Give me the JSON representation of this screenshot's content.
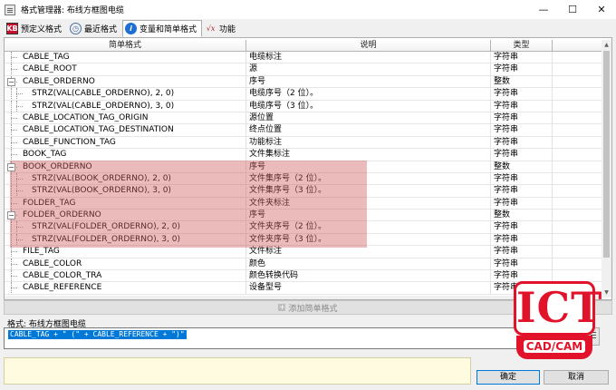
{
  "window": {
    "title": "格式管理器: 布线方框图电缆",
    "minimize": "—",
    "maximize": "☐",
    "close": "✕"
  },
  "tabs": [
    {
      "label": "预定义格式",
      "icon": "predefined-format-icon"
    },
    {
      "label": "最近格式",
      "icon": "clock-icon"
    },
    {
      "label": "变量和简单格式",
      "icon": "info-icon"
    },
    {
      "label": "功能",
      "icon": "function-fx-icon"
    }
  ],
  "active_tab": 2,
  "table": {
    "headers": [
      "简单格式",
      "说明",
      "类型",
      ""
    ],
    "rows": [
      {
        "name": "CABLE_TAG",
        "desc": "电缆标注",
        "type": "字符串",
        "level": 0,
        "expander": ""
      },
      {
        "name": "CABLE_ROOT",
        "desc": "源",
        "type": "字符串",
        "level": 0,
        "expander": ""
      },
      {
        "name": "CABLE_ORDERNO",
        "desc": "序号",
        "type": "整数",
        "level": 0,
        "expander": "−"
      },
      {
        "name": "STRZ(VAL(CABLE_ORDERNO), 2, 0)",
        "desc": "电缆序号（2 位）。",
        "type": "字符串",
        "level": 1,
        "expander": ""
      },
      {
        "name": "STRZ(VAL(CABLE_ORDERNO), 3, 0)",
        "desc": "电缆序号（3 位）。",
        "type": "字符串",
        "level": 1,
        "expander": ""
      },
      {
        "name": "CABLE_LOCATION_TAG_ORIGIN",
        "desc": "源位置",
        "type": "字符串",
        "level": 0,
        "expander": ""
      },
      {
        "name": "CABLE_LOCATION_TAG_DESTINATION",
        "desc": "终点位置",
        "type": "字符串",
        "level": 0,
        "expander": ""
      },
      {
        "name": "CABLE_FUNCTION_TAG",
        "desc": "功能标注",
        "type": "字符串",
        "level": 0,
        "expander": ""
      },
      {
        "name": "BOOK_TAG",
        "desc": "文件集标注",
        "type": "字符串",
        "level": 0,
        "expander": ""
      },
      {
        "name": "BOOK_ORDERNO",
        "desc": "序号",
        "type": "整数",
        "level": 0,
        "expander": "−"
      },
      {
        "name": "STRZ(VAL(BOOK_ORDERNO), 2, 0)",
        "desc": "文件集序号（2 位）。",
        "type": "字符串",
        "level": 1,
        "expander": ""
      },
      {
        "name": "STRZ(VAL(BOOK_ORDERNO), 3, 0)",
        "desc": "文件集序号（3 位）。",
        "type": "字符串",
        "level": 1,
        "expander": ""
      },
      {
        "name": "FOLDER_TAG",
        "desc": "文件夹标注",
        "type": "字符串",
        "level": 0,
        "expander": ""
      },
      {
        "name": "FOLDER_ORDERNO",
        "desc": "序号",
        "type": "整数",
        "level": 0,
        "expander": "−"
      },
      {
        "name": "STRZ(VAL(FOLDER_ORDERNO), 2, 0)",
        "desc": "文件夹序号（2 位）。",
        "type": "字符串",
        "level": 1,
        "expander": ""
      },
      {
        "name": "STRZ(VAL(FOLDER_ORDERNO), 3, 0)",
        "desc": "文件夹序号（3 位）。",
        "type": "字符串",
        "level": 1,
        "expander": ""
      },
      {
        "name": "FILE_TAG",
        "desc": "文件标注",
        "type": "字符串",
        "level": 0,
        "expander": ""
      },
      {
        "name": "CABLE_COLOR",
        "desc": "颜色",
        "type": "字符串",
        "level": 0,
        "expander": ""
      },
      {
        "name": "CABLE_COLOR_TRA",
        "desc": "颜色转换代码",
        "type": "字符串",
        "level": 0,
        "expander": ""
      },
      {
        "name": "CABLE_REFERENCE",
        "desc": "设备型号",
        "type": "字符串",
        "level": 0,
        "expander": ""
      }
    ]
  },
  "add_button": {
    "label": "添加简单格式",
    "plus": "+"
  },
  "format": {
    "label": "格式: 布线方框图电缆",
    "value": "CABLE_TAG + \" (\" + CABLE_REFERENCE + \")\""
  },
  "buttons": {
    "ok": "确定",
    "cancel": "取消"
  },
  "logo": {
    "top": "ICT",
    "bottom": "CAD/CAM"
  },
  "colors": {
    "highlight": "#cf5a5a",
    "accent": "#0078d7",
    "logo": "#e1122a"
  }
}
